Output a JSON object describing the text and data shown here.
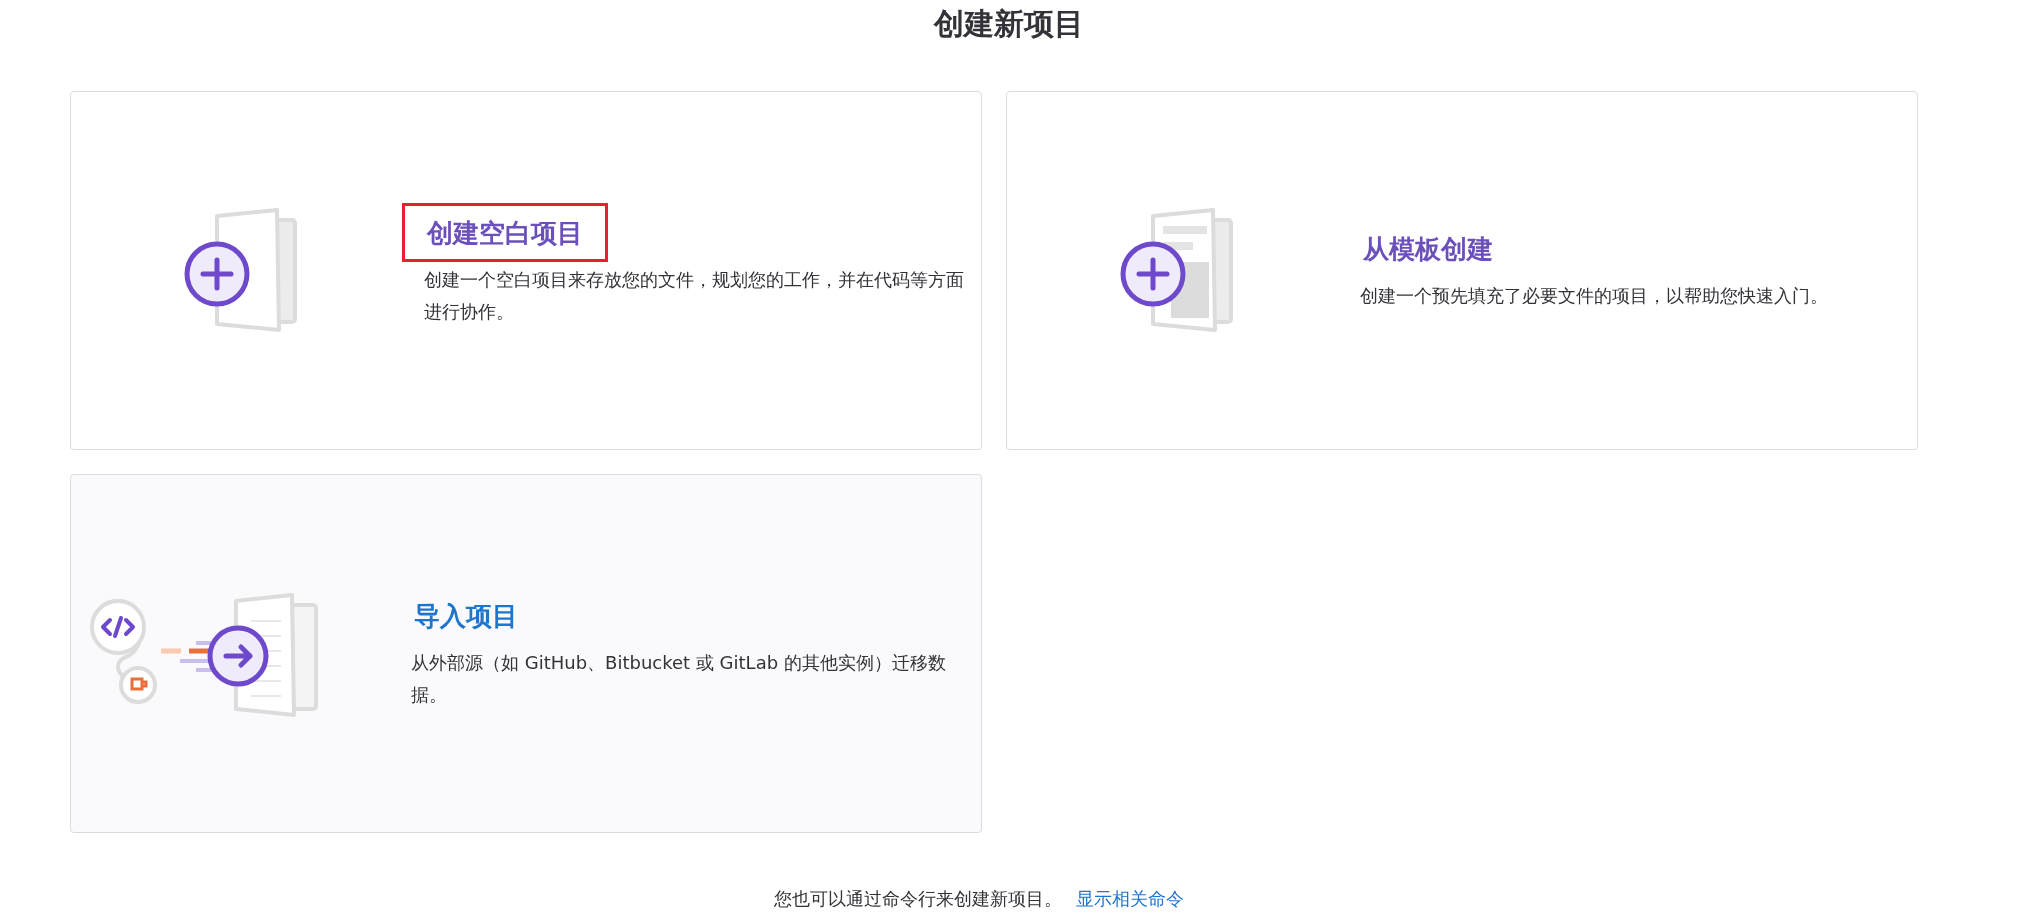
{
  "page_title": "创建新项目",
  "cards": [
    {
      "kind": "blank",
      "title": "创建空白项目",
      "description": "创建一个空白项目来存放您的文件，规划您的工作，并在代码等方面进行协作。",
      "highlighted": true,
      "hovered": false
    },
    {
      "kind": "template",
      "title": "从模板创建",
      "description": "创建一个预先填充了必要文件的项目，以帮助您快速入门。",
      "highlighted": false,
      "hovered": false
    },
    {
      "kind": "import",
      "title": "导入项目",
      "description": "从外部源（如 GitHub、Bitbucket 或 GitLab 的其他实例）迁移数据。",
      "highlighted": false,
      "hovered": true
    }
  ],
  "footer": {
    "text": "您也可以通过命令行来创建新项目。",
    "link": "显示相关命令"
  }
}
